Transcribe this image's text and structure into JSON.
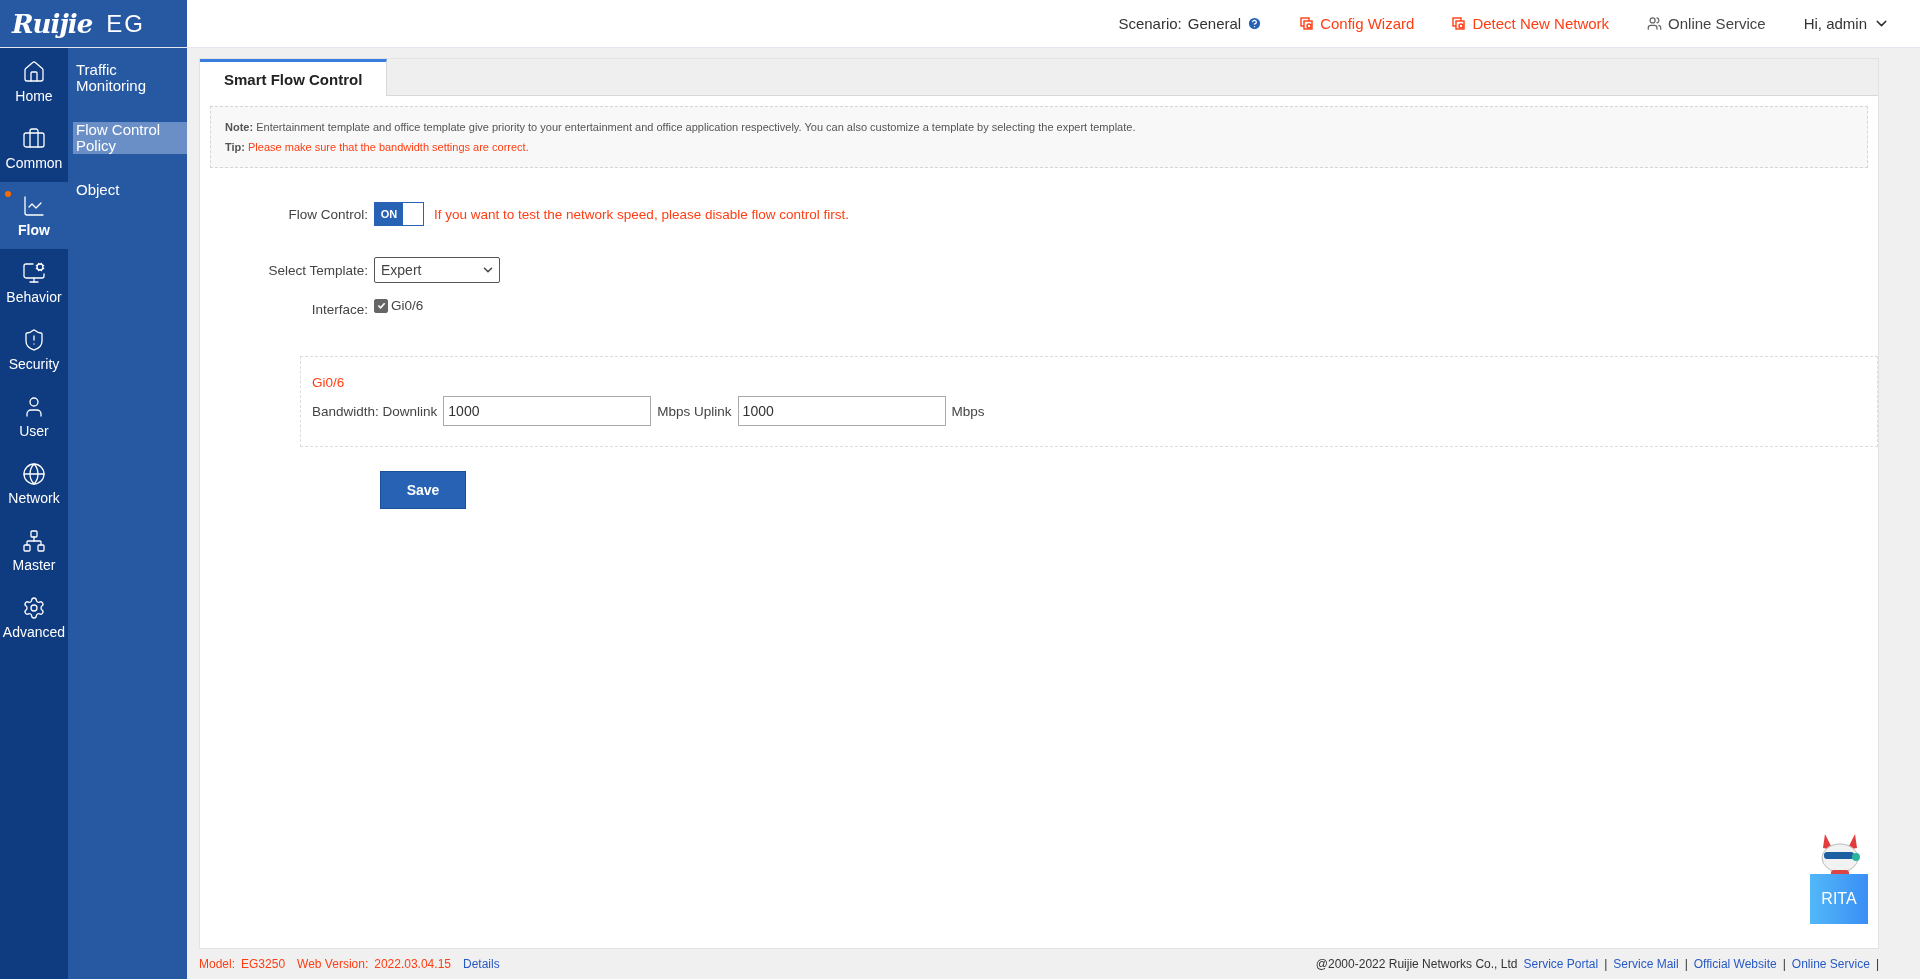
{
  "brand": {
    "logo": "Ruijie",
    "product": "EG"
  },
  "header": {
    "scenario_label": "Scenario:",
    "scenario_value": "General",
    "links": [
      {
        "label": "Config Wizard",
        "kind": "wizard"
      },
      {
        "label": "Detect New Network",
        "kind": "wizard"
      },
      {
        "label": "Online Service",
        "kind": "service"
      }
    ],
    "user": "Hi, admin"
  },
  "nav": [
    {
      "label": "Home",
      "selected": false,
      "dot": false
    },
    {
      "label": "Common",
      "selected": false,
      "dot": false
    },
    {
      "label": "Flow",
      "selected": true,
      "dot": true
    },
    {
      "label": "Behavior",
      "selected": false,
      "dot": false
    },
    {
      "label": "Security",
      "selected": false,
      "dot": false
    },
    {
      "label": "User",
      "selected": false,
      "dot": false
    },
    {
      "label": "Network",
      "selected": false,
      "dot": false
    },
    {
      "label": "Master",
      "selected": false,
      "dot": false
    },
    {
      "label": "Advanced",
      "selected": false,
      "dot": false
    }
  ],
  "submenu": [
    {
      "label": "Traffic Monitoring",
      "selected": false
    },
    {
      "label": "Flow Control Policy",
      "selected": true
    },
    {
      "label": "Object",
      "selected": false
    }
  ],
  "tabs": [
    {
      "label": "Smart Flow Control",
      "selected": true
    }
  ],
  "notice": {
    "note_label": "Note:",
    "note": "Entertainment template and office template give priority to your entertainment and office application respectively. You can also customize a template by selecting the expert template.",
    "tip_label": "Tip:",
    "tip": "Please make sure that the bandwidth settings are correct."
  },
  "form": {
    "flow_control_label": "Flow Control:",
    "flow_control": {
      "label": "ON",
      "on": true
    },
    "flow_control_warning": "If you want to test the network speed, please disable flow control first.",
    "template_label": "Select Template:",
    "template": "Expert",
    "interface_label": "Interface:",
    "interfaces": [
      {
        "label": "Gi0/6",
        "checked": true
      }
    ]
  },
  "bandwidth": [
    {
      "title": "Gi0/6",
      "label": "Bandwidth: Downlink",
      "downlink": "1000",
      "mid_label": "Mbps Uplink",
      "uplink": "1000",
      "unit": "Mbps"
    }
  ],
  "save": "Save",
  "assistant": {
    "label": "RITA"
  },
  "footer": {
    "model_label": "Model:",
    "model": "EG3250",
    "version_label": "Web Version:",
    "version": "2022.03.04.15",
    "details": "Details",
    "copyright": "@2000-2022 Ruijie Networks Co., Ltd",
    "links": [
      {
        "label": "Service Portal",
        "separator": "|"
      },
      {
        "label": "Service Mail",
        "separator": "|"
      },
      {
        "label": "Official Website",
        "separator": "|"
      },
      {
        "label": "Online Service",
        "separator": "|"
      }
    ]
  }
}
